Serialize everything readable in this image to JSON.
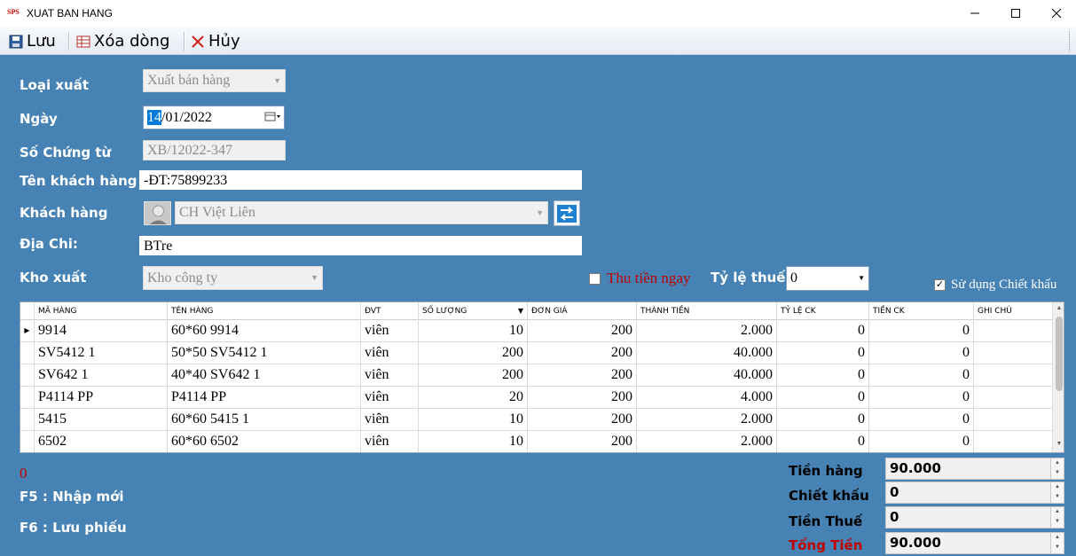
{
  "window": {
    "icon_text": "SPS",
    "title": "XUAT BAN HANG",
    "controls": {
      "minimize": "—",
      "maximize": "☐",
      "close": "✕"
    }
  },
  "toolbar": {
    "save_label": "Lưu",
    "delete_row_label": "Xóa dòng",
    "cancel_label": "Hủy"
  },
  "form": {
    "loai_xuat": {
      "label": "Loại xuất",
      "value": "Xuất bán hàng"
    },
    "ngay": {
      "label": "Ngày",
      "value_selected": "14",
      "value_rest": "/01/2022"
    },
    "so_chung_tu": {
      "label": "Số Chứng từ",
      "value": "XB/12022-347"
    },
    "ten_khach_hang": {
      "label": "Tên khách hàng",
      "value": "-ĐT:75899233"
    },
    "khach_hang": {
      "label": "Khách hàng",
      "value": "CH Việt Liên"
    },
    "dia_chi": {
      "label": "Địa Chi:",
      "value": "BTre"
    },
    "kho_xuat": {
      "label": "Kho xuất",
      "value": "Kho công ty"
    },
    "thu_tien_ngay": {
      "label": "Thu tiền ngay",
      "checked": false
    },
    "ty_le_thue": {
      "label": "Tỷ lệ thuế",
      "value": "0"
    },
    "su_dung_chiet_khau": {
      "label": "Sử dụng Chiết khấu",
      "checked": true
    }
  },
  "grid": {
    "columns": [
      "MÃ HÀNG",
      "TÊN HÀNG",
      "ĐVT",
      "SỐ LƯỢNG",
      "ĐƠN GIÁ",
      "THÀNH TIỀN",
      "TỶ LỆ CK",
      "TIỀN CK",
      "GHI CHÚ"
    ],
    "rows": [
      [
        "9914",
        "60*60 9914",
        "viên",
        "10",
        "200",
        "2.000",
        "0",
        "0",
        ""
      ],
      [
        "SV5412 1",
        "50*50 SV5412 1",
        "viên",
        "200",
        "200",
        "40.000",
        "0",
        "0",
        ""
      ],
      [
        "SV642 1",
        "40*40 SV642 1",
        "viên",
        "200",
        "200",
        "40.000",
        "0",
        "0",
        ""
      ],
      [
        "P4114 PP",
        "P4114 PP",
        "viên",
        "20",
        "200",
        "4.000",
        "0",
        "0",
        ""
      ],
      [
        "5415",
        "60*60 5415 1",
        "viên",
        "10",
        "200",
        "2.000",
        "0",
        "0",
        ""
      ],
      [
        "6502",
        "60*60 6502",
        "viên",
        "10",
        "200",
        "2.000",
        "0",
        "0",
        ""
      ]
    ]
  },
  "footer": {
    "count": "0",
    "hint_f5": "F5 : Nhập mới",
    "hint_f6": "F6 : Lưu phiếu"
  },
  "totals": {
    "tien_hang": {
      "label": "Tiền hàng",
      "value": "90.000"
    },
    "chiet_khau": {
      "label": "Chiết khấu",
      "value": "0"
    },
    "tien_thue": {
      "label": "Tiền Thuế",
      "value": "0"
    },
    "tong_tien": {
      "label": "Tổng Tiền",
      "value": "90.000"
    }
  },
  "colors": {
    "background": "#4682b4",
    "accent_red": "#c00000",
    "selection": "#0078d7"
  }
}
